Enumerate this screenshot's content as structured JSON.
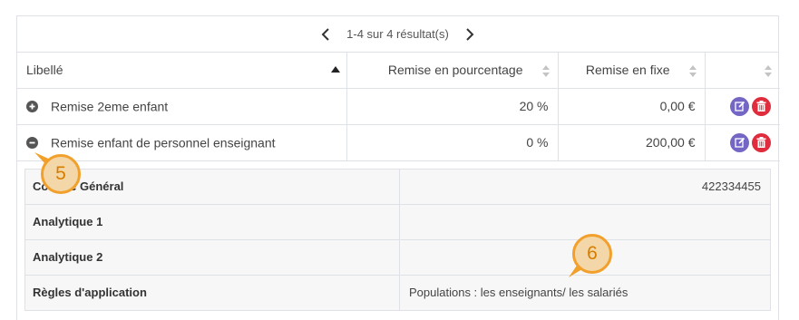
{
  "pager": {
    "info": "1-4 sur 4 résultat(s)"
  },
  "columns": {
    "label": "Libellé",
    "percent": "Remise en pourcentage",
    "fixed": "Remise en fixe"
  },
  "rows": [
    {
      "label": "Remise 2eme enfant",
      "percent": "20 %",
      "fixed": "0,00 €",
      "expanded": false
    },
    {
      "label": "Remise enfant de personnel enseignant",
      "percent": "0 %",
      "fixed": "200,00 €",
      "expanded": true
    }
  ],
  "details": [
    {
      "key": "Compte Général",
      "value": "422334455"
    },
    {
      "key": "Analytique 1",
      "value": ""
    },
    {
      "key": "Analytique 2",
      "value": ""
    },
    {
      "key": "Règles d'application",
      "value": "Populations : les enseignants/ les salariés"
    }
  ],
  "callouts": {
    "first": "5",
    "second": "6"
  },
  "colors": {
    "edit": "#7366c4",
    "delete": "#e02c3c",
    "callout_border": "#f2a02c",
    "callout_fill": "#f4d7a8"
  }
}
